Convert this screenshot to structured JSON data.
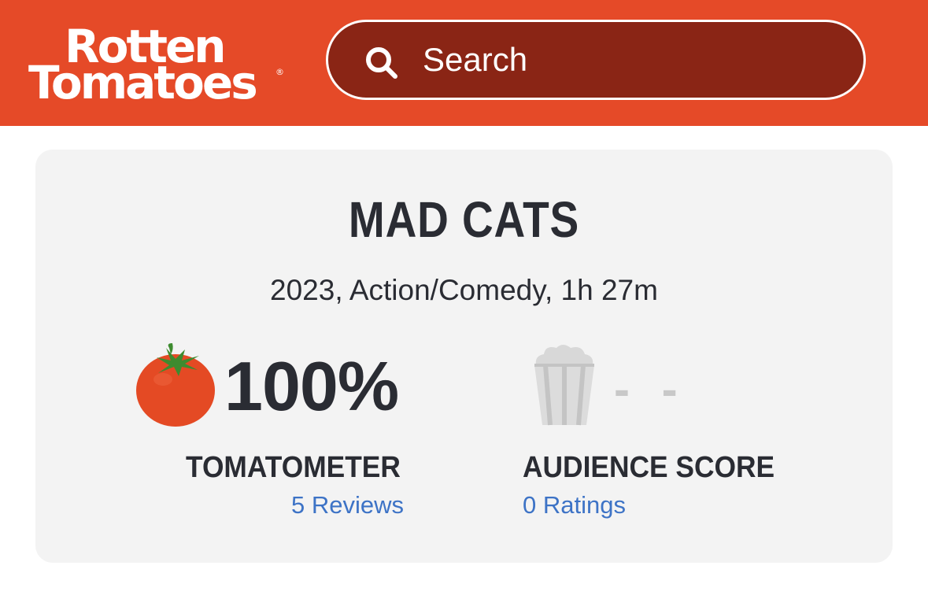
{
  "header": {
    "logo": {
      "line1": "Rotten",
      "line2": "Tomatoes",
      "registered": "®"
    },
    "search": {
      "placeholder": "Search",
      "icon": "search-icon"
    }
  },
  "movie": {
    "title": "MAD CATS",
    "meta": "2023, Action/Comedy, 1h 27m",
    "tomatometer": {
      "icon": "tomato-icon",
      "score": "100%",
      "label": "TOMATOMETER",
      "link": "5 Reviews"
    },
    "audience": {
      "icon": "popcorn-bucket-icon",
      "score": "- -",
      "label": "AUDIENCE SCORE",
      "link": "0 Ratings"
    }
  },
  "colors": {
    "header_bg": "#e54a28",
    "search_bg": "#8a2515",
    "card_bg": "#f3f3f3",
    "text": "#2a2c33",
    "link": "#3d73c6",
    "muted": "#c8c8c8"
  }
}
